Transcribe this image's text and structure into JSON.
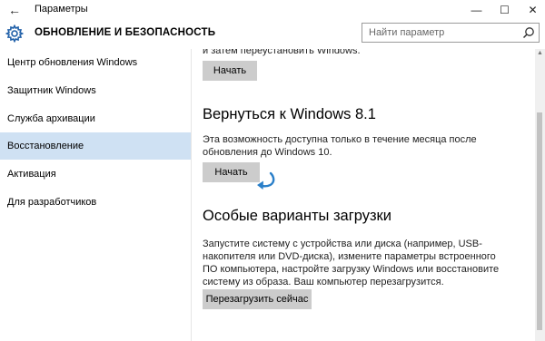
{
  "window": {
    "title": "Параметры",
    "back_glyph": "←",
    "minimize_glyph": "—",
    "maximize_glyph": "☐",
    "close_glyph": "✕"
  },
  "header": {
    "section_title": "ОБНОВЛЕНИЕ И БЕЗОПАСНОСТЬ",
    "icon": "gear-icon"
  },
  "search": {
    "placeholder": "Найти параметр",
    "value": "",
    "icon": "search-icon"
  },
  "sidebar": {
    "items": [
      {
        "label": "Центр обновления Windows",
        "active": false
      },
      {
        "label": "Защитник Windows",
        "active": false
      },
      {
        "label": "Служба архивации",
        "active": false
      },
      {
        "label": "Восстановление",
        "active": true
      },
      {
        "label": "Активация",
        "active": false
      },
      {
        "label": "Для разработчиков",
        "active": false
      }
    ],
    "active_color": "#cfe1f3"
  },
  "content": {
    "reset_section": {
      "text_tail": "и затем переустановить Windows.",
      "button": "Начать"
    },
    "rollback_section": {
      "heading": "Вернуться к Windows 8.1",
      "text_line1": "Эта возможность доступна только в течение месяца после",
      "text_line2": "обновления до Windows 10.",
      "button": "Начать",
      "annotation": "curved-arrow-icon",
      "annotation_color": "#2a7fc9"
    },
    "advanced_section": {
      "heading": "Особые варианты загрузки",
      "text_line1": "Запустите систему с устройства или диска (например, USB-",
      "text_line2": "накопителя или DVD-диска), измените параметры встроенного",
      "text_line3": "ПО компьютера, настройте загрузку Windows или восстановите",
      "text_line4": "систему из образа. Ваш компьютер перезагрузится.",
      "button": "Перезагрузить сейчас"
    }
  }
}
